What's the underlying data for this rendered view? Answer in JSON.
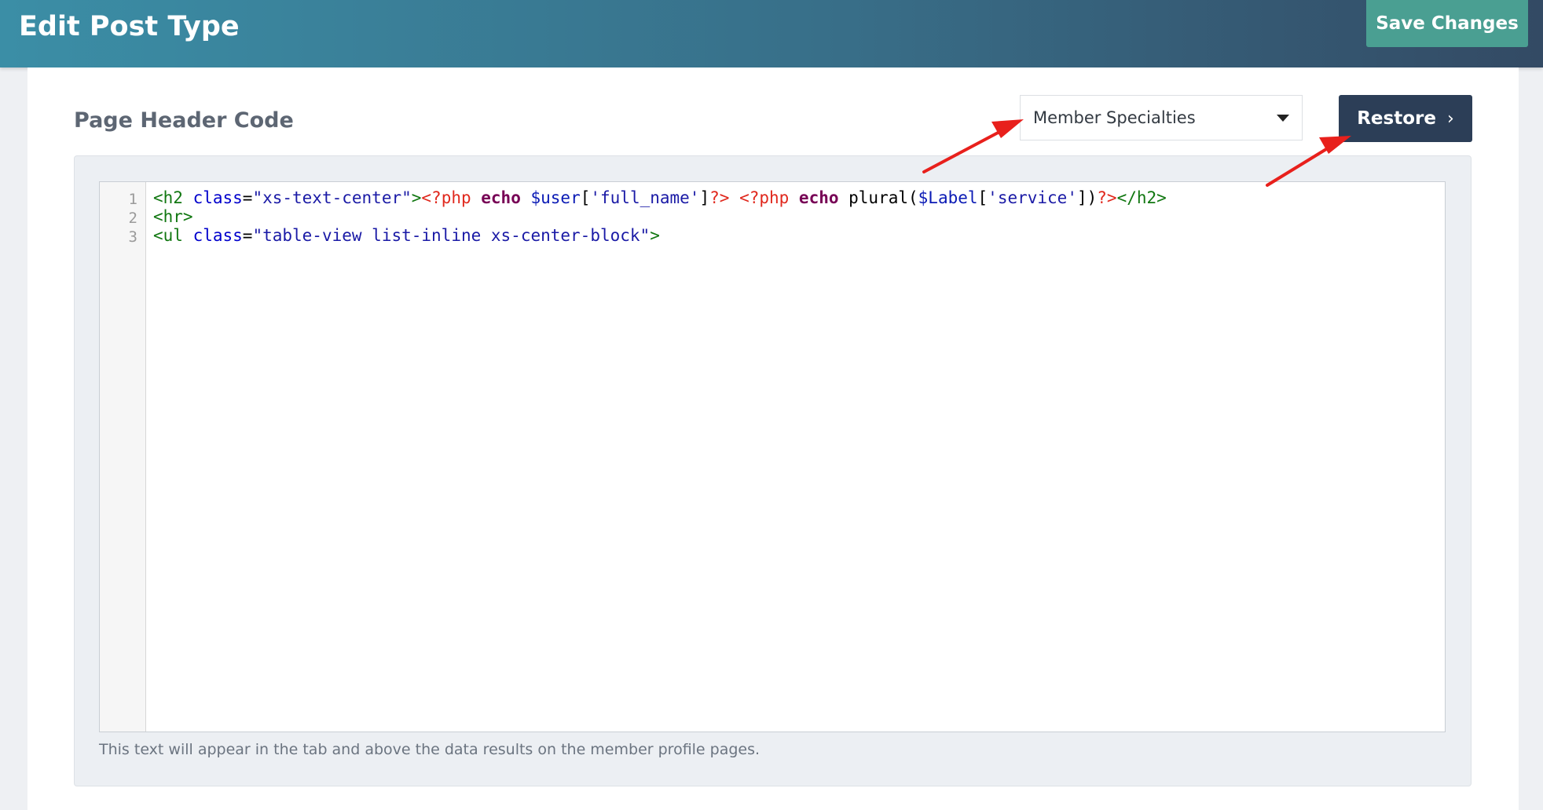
{
  "header": {
    "title": "Edit Post Type",
    "save_label": "Save Changes"
  },
  "section": {
    "title": "Page Header Code",
    "dropdown_value": "Member Specialties",
    "restore_label": "Restore",
    "help_text": "This text will appear in the tab and above the data results on the member profile pages."
  },
  "editor": {
    "line_numbers": [
      "1",
      "2",
      "3"
    ],
    "lines": [
      [
        {
          "t": "tag",
          "v": "<h2 "
        },
        {
          "t": "attr",
          "v": "class"
        },
        {
          "t": "plain",
          "v": "="
        },
        {
          "t": "str",
          "v": "\"xs-text-center\""
        },
        {
          "t": "tag",
          "v": ">"
        },
        {
          "t": "meta",
          "v": "<?php "
        },
        {
          "t": "kw",
          "v": "echo"
        },
        {
          "t": "plain",
          "v": " "
        },
        {
          "t": "var",
          "v": "$user"
        },
        {
          "t": "plain",
          "v": "["
        },
        {
          "t": "str",
          "v": "'full_name'"
        },
        {
          "t": "plain",
          "v": "]"
        },
        {
          "t": "meta",
          "v": "?>"
        },
        {
          "t": "plain",
          "v": " "
        },
        {
          "t": "meta",
          "v": "<?php "
        },
        {
          "t": "kw",
          "v": "echo"
        },
        {
          "t": "plain",
          "v": " plural("
        },
        {
          "t": "var",
          "v": "$Label"
        },
        {
          "t": "plain",
          "v": "["
        },
        {
          "t": "str",
          "v": "'service'"
        },
        {
          "t": "plain",
          "v": "])"
        },
        {
          "t": "meta",
          "v": "?>"
        },
        {
          "t": "tag",
          "v": "</h2>"
        }
      ],
      [
        {
          "t": "tag",
          "v": "<hr>"
        }
      ],
      [
        {
          "t": "tag",
          "v": "<ul "
        },
        {
          "t": "attr",
          "v": "class"
        },
        {
          "t": "plain",
          "v": "="
        },
        {
          "t": "str",
          "v": "\"table-view list-inline xs-center-block\""
        },
        {
          "t": "tag",
          "v": ">"
        }
      ]
    ]
  },
  "colors": {
    "header_gradient_start": "#3b8ea6",
    "header_gradient_end": "#334a64",
    "save_button": "#4a9f92",
    "restore_button": "#2c3e57",
    "annotation_arrow": "#e8201c"
  },
  "icons": {
    "dropdown": "caret-down-icon",
    "restore": "chevron-right-icon",
    "annotation": "red-arrow-annotation"
  }
}
